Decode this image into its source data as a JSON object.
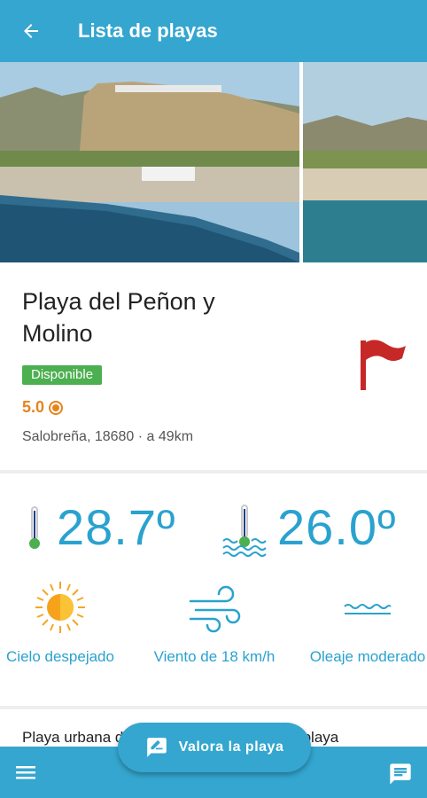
{
  "appbar": {
    "title": "Lista de playas",
    "back_icon": "arrow-back-icon"
  },
  "beach": {
    "name": "Playa del Peñon y Molino",
    "status": "Disponible",
    "rating": "5.0",
    "location": "Salobreña, 18680 · a 49km",
    "flag_color": "#c62828"
  },
  "weather": {
    "air_temp": "28.7º",
    "water_temp": "26.0º",
    "sky_label": "Cielo despejado",
    "wind_label": "Viento de 18 km/h",
    "waves_label": "Oleaje moderado"
  },
  "description": "Playa urbana de arena y grava fina. Es la playa",
  "fab": {
    "label": "Valora la playa",
    "icon": "rate-edit-icon"
  },
  "bottom_nav": {
    "menu_icon": "menu-icon",
    "chat_icon": "chat-icon"
  },
  "colors": {
    "primary": "#34a6cf",
    "accent_text": "#2aa2cf",
    "badge": "#4caf50",
    "rating": "#e6841e"
  }
}
